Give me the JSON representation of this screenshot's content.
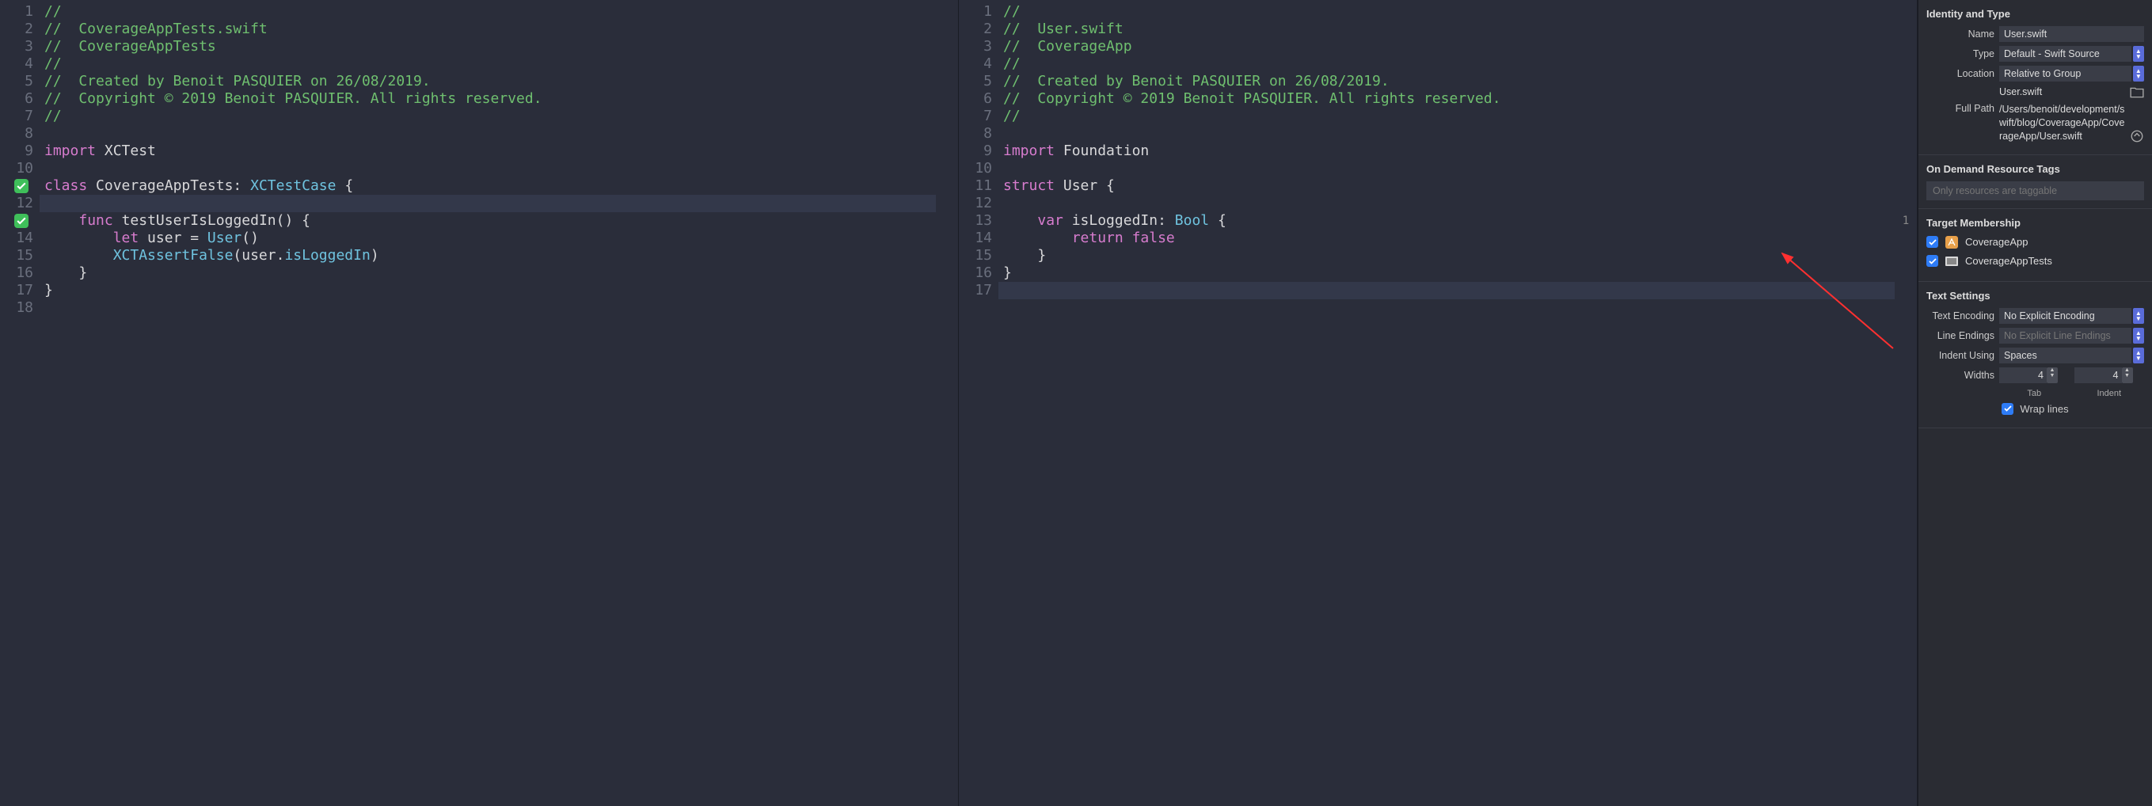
{
  "editor_left": {
    "lines": [
      {
        "n": 1,
        "tokens": [
          {
            "c": "cmt",
            "t": "//"
          }
        ]
      },
      {
        "n": 2,
        "tokens": [
          {
            "c": "cmt",
            "t": "//  CoverageAppTests.swift"
          }
        ]
      },
      {
        "n": 3,
        "tokens": [
          {
            "c": "cmt",
            "t": "//  CoverageAppTests"
          }
        ]
      },
      {
        "n": 4,
        "tokens": [
          {
            "c": "cmt",
            "t": "//"
          }
        ]
      },
      {
        "n": 5,
        "tokens": [
          {
            "c": "cmt",
            "t": "//  Created by Benoit PASQUIER on 26/08/2019."
          }
        ]
      },
      {
        "n": 6,
        "tokens": [
          {
            "c": "cmt",
            "t": "//  Copyright © 2019 Benoit PASQUIER. All rights reserved."
          }
        ]
      },
      {
        "n": 7,
        "tokens": [
          {
            "c": "cmt",
            "t": "//"
          }
        ]
      },
      {
        "n": 8,
        "tokens": [
          {
            "c": "",
            "t": ""
          }
        ]
      },
      {
        "n": 9,
        "tokens": [
          {
            "c": "kw",
            "t": "import"
          },
          {
            "c": "",
            "t": " "
          },
          {
            "c": "",
            "t": "XCTest"
          }
        ]
      },
      {
        "n": 10,
        "tokens": [
          {
            "c": "",
            "t": ""
          }
        ]
      },
      {
        "n": 11,
        "badge": true,
        "tokens": [
          {
            "c": "kw",
            "t": "class"
          },
          {
            "c": "",
            "t": " "
          },
          {
            "c": "",
            "t": "CoverageAppTests: "
          },
          {
            "c": "type",
            "t": "XCTestCase"
          },
          {
            "c": "",
            "t": " {"
          }
        ]
      },
      {
        "n": 12,
        "hl": true,
        "tokens": [
          {
            "c": "",
            "t": ""
          }
        ]
      },
      {
        "n": 13,
        "badge": true,
        "tokens": [
          {
            "c": "",
            "t": "    "
          },
          {
            "c": "kw",
            "t": "func"
          },
          {
            "c": "",
            "t": " "
          },
          {
            "c": "",
            "t": "testUserIsLoggedIn() {"
          }
        ]
      },
      {
        "n": 14,
        "tokens": [
          {
            "c": "",
            "t": "        "
          },
          {
            "c": "kw",
            "t": "let"
          },
          {
            "c": "",
            "t": " user = "
          },
          {
            "c": "type",
            "t": "User"
          },
          {
            "c": "",
            "t": "()"
          }
        ]
      },
      {
        "n": 15,
        "tokens": [
          {
            "c": "",
            "t": "        "
          },
          {
            "c": "func",
            "t": "XCTAssertFalse"
          },
          {
            "c": "",
            "t": "(user."
          },
          {
            "c": "type",
            "t": "isLoggedIn"
          },
          {
            "c": "",
            "t": ")"
          }
        ]
      },
      {
        "n": 16,
        "tokens": [
          {
            "c": "",
            "t": "    }"
          }
        ]
      },
      {
        "n": 17,
        "tokens": [
          {
            "c": "",
            "t": "}"
          }
        ]
      },
      {
        "n": 18,
        "tokens": [
          {
            "c": "",
            "t": ""
          }
        ]
      }
    ]
  },
  "editor_right": {
    "lines": [
      {
        "n": 1,
        "tokens": [
          {
            "c": "cmt",
            "t": "//"
          }
        ]
      },
      {
        "n": 2,
        "tokens": [
          {
            "c": "cmt",
            "t": "//  User.swift"
          }
        ]
      },
      {
        "n": 3,
        "tokens": [
          {
            "c": "cmt",
            "t": "//  CoverageApp"
          }
        ]
      },
      {
        "n": 4,
        "tokens": [
          {
            "c": "cmt",
            "t": "//"
          }
        ]
      },
      {
        "n": 5,
        "tokens": [
          {
            "c": "cmt",
            "t": "//  Created by Benoit PASQUIER on 26/08/2019."
          }
        ]
      },
      {
        "n": 6,
        "tokens": [
          {
            "c": "cmt",
            "t": "//  Copyright © 2019 Benoit PASQUIER. All rights reserved."
          }
        ]
      },
      {
        "n": 7,
        "tokens": [
          {
            "c": "cmt",
            "t": "//"
          }
        ]
      },
      {
        "n": 8,
        "tokens": [
          {
            "c": "",
            "t": ""
          }
        ]
      },
      {
        "n": 9,
        "tokens": [
          {
            "c": "kw",
            "t": "import"
          },
          {
            "c": "",
            "t": " "
          },
          {
            "c": "",
            "t": "Foundation"
          }
        ]
      },
      {
        "n": 10,
        "tokens": [
          {
            "c": "",
            "t": ""
          }
        ]
      },
      {
        "n": 11,
        "tokens": [
          {
            "c": "kw",
            "t": "struct"
          },
          {
            "c": "",
            "t": " "
          },
          {
            "c": "",
            "t": "User {"
          }
        ]
      },
      {
        "n": 12,
        "tokens": [
          {
            "c": "",
            "t": ""
          }
        ]
      },
      {
        "n": 13,
        "cov": "1",
        "tokens": [
          {
            "c": "",
            "t": "    "
          },
          {
            "c": "kw",
            "t": "var"
          },
          {
            "c": "",
            "t": " isLoggedIn: "
          },
          {
            "c": "type",
            "t": "Bool"
          },
          {
            "c": "",
            "t": " {"
          }
        ]
      },
      {
        "n": 14,
        "tokens": [
          {
            "c": "",
            "t": "        "
          },
          {
            "c": "kw",
            "t": "return"
          },
          {
            "c": "",
            "t": " "
          },
          {
            "c": "bool",
            "t": "false"
          }
        ]
      },
      {
        "n": 15,
        "tokens": [
          {
            "c": "",
            "t": "    }"
          }
        ]
      },
      {
        "n": 16,
        "tokens": [
          {
            "c": "",
            "t": "}"
          }
        ]
      },
      {
        "n": 17,
        "hl": true,
        "tokens": [
          {
            "c": "",
            "t": ""
          }
        ]
      }
    ]
  },
  "inspector": {
    "identity": {
      "title": "Identity and Type",
      "name_label": "Name",
      "name_value": "User.swift",
      "type_label": "Type",
      "type_value": "Default - Swift Source",
      "location_label": "Location",
      "location_value": "Relative to Group",
      "location_file": "User.swift",
      "fullpath_label": "Full Path",
      "fullpath_value": "/Users/benoit/development/swift/blog/CoverageApp/CoverageApp/User.swift"
    },
    "ondemand": {
      "title": "On Demand Resource Tags",
      "placeholder": "Only resources are taggable"
    },
    "targets": {
      "title": "Target Membership",
      "items": [
        {
          "label": "CoverageApp",
          "checked": true,
          "icon": "app"
        },
        {
          "label": "CoverageAppTests",
          "checked": true,
          "icon": "tests"
        }
      ]
    },
    "text": {
      "title": "Text Settings",
      "encoding_label": "Text Encoding",
      "encoding_value": "No Explicit Encoding",
      "endings_label": "Line Endings",
      "endings_value": "No Explicit Line Endings",
      "indent_label": "Indent Using",
      "indent_value": "Spaces",
      "widths_label": "Widths",
      "tab_value": "4",
      "indent_value2": "4",
      "tab_label": "Tab",
      "indent_label2": "Indent",
      "wrap_label": "Wrap lines"
    }
  }
}
